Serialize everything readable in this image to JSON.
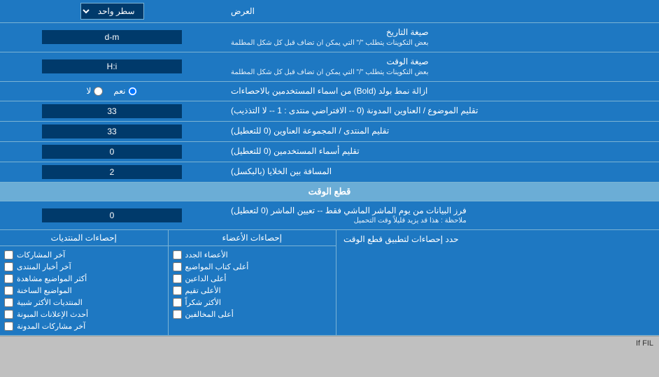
{
  "page": {
    "title": "العرض",
    "section_time_cut": "قطع الوقت",
    "rows": [
      {
        "id": "display_mode",
        "label": "العرض",
        "input_type": "select",
        "value": "سطر واحد"
      },
      {
        "id": "date_format",
        "label": "صيغة التاريخ",
        "sublabel": "بعض التكوينات يتطلب \"/\" التي يمكن ان تضاف قبل كل شكل المطلمة",
        "input_type": "text",
        "value": "d-m"
      },
      {
        "id": "time_format",
        "label": "صيغة الوقت",
        "sublabel": "بعض التكوينات يتطلب \"/\" التي يمكن ان تضاف قبل كل شكل المطلمة",
        "input_type": "text",
        "value": "H:i"
      },
      {
        "id": "bold_remove",
        "label": "ازالة نمط بولد (Bold) من اسماء المستخدمين بالاحصاءات",
        "input_type": "radio",
        "options": [
          "نعم",
          "لا"
        ],
        "selected": "نعم"
      },
      {
        "id": "topic_titles",
        "label": "تقليم الموضوع / العناوين المدونة (0 -- الافتراضي منتدى : 1 -- لا التذذيب)",
        "input_type": "text",
        "value": "33"
      },
      {
        "id": "forum_titles",
        "label": "تقليم المنتدى / المجموعة العناوين (0 للتعطيل)",
        "input_type": "text",
        "value": "33"
      },
      {
        "id": "user_names",
        "label": "تقليم أسماء المستخدمين (0 للتعطيل)",
        "input_type": "text",
        "value": "0"
      },
      {
        "id": "cell_spacing",
        "label": "المسافة بين الخلايا (بالبكسل)",
        "input_type": "text",
        "value": "2"
      }
    ],
    "time_cut_row": {
      "label": "فرز البيانات من يوم الماشر الماشي فقط -- تعيين الماشر (0 لتعطيل)",
      "sublabel": "ملاحظة : هذا قد يزيد قليلاً وقت التحميل",
      "value": "0"
    },
    "stats_limit_label": "حدد إحصاءات لتطبيق قطع الوقت",
    "checkbox_columns": [
      {
        "header": "إحصاءات الأعضاء",
        "items": [
          "الأعضاء الجدد",
          "أعلى كتاب المواضيع",
          "أعلى الداعين",
          "الأعلى تقيم",
          "الأكثر شكراً",
          "أعلى المخالفين"
        ]
      },
      {
        "header": "إحصاءات المنتديات",
        "items": [
          "آخر المشاركات",
          "آخر أخبار المنتدى",
          "أكثر المواضيع مشاهدة",
          "المواضيع الساخنة",
          "المنتديات الأكثر شبية",
          "أحدث الإعلانات المبونة",
          "آخر مشاركات المدونة"
        ]
      }
    ]
  }
}
